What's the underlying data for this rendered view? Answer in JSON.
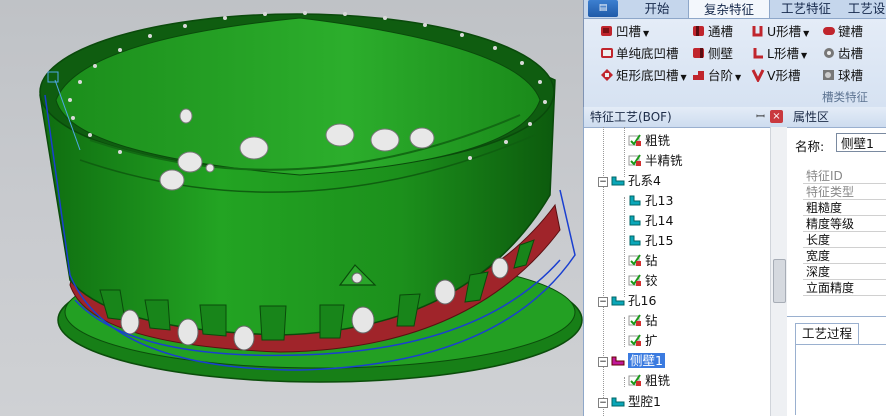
{
  "ribbon": {
    "app_button": "",
    "tabs": [
      {
        "label": "开始"
      },
      {
        "label": "复杂特征",
        "active": true
      },
      {
        "label": "工艺特征"
      },
      {
        "label": "工艺设"
      }
    ],
    "buttons": [
      {
        "label": "凹槽",
        "dropdown": true,
        "icon": "groove-icon"
      },
      {
        "label": "通槽",
        "icon": "through-slot-icon"
      },
      {
        "label": "U形槽",
        "dropdown": true,
        "icon": "u-slot-icon"
      },
      {
        "label": "键槽",
        "icon": "keyway-icon"
      },
      {
        "label": "单纯底凹槽",
        "icon": "simple-bottom-groove-icon"
      },
      {
        "label": "侧壁",
        "icon": "side-wall-icon"
      },
      {
        "label": "L形槽",
        "dropdown": true,
        "icon": "l-slot-icon"
      },
      {
        "label": "齿槽",
        "icon": "tooth-slot-icon"
      },
      {
        "label": "矩形底凹槽",
        "dropdown": true,
        "icon": "rect-bottom-groove-icon"
      },
      {
        "label": "台阶",
        "dropdown": true,
        "icon": "step-icon"
      },
      {
        "label": "V形槽",
        "icon": "v-slot-icon"
      },
      {
        "label": "球槽",
        "icon": "ball-slot-icon"
      }
    ],
    "group_label": "槽类特征"
  },
  "tree_panel": {
    "title": "特征工艺(BOF)",
    "pin": "ꟷ",
    "close": "×",
    "nodes": [
      {
        "label": "粗铣",
        "icon": "operation-icon"
      },
      {
        "label": "半精铣",
        "icon": "operation-icon"
      },
      {
        "label": "孔系4",
        "icon": "feature-icon",
        "expander": "−"
      },
      {
        "label": "孔13",
        "icon": "hole-icon"
      },
      {
        "label": "孔14",
        "icon": "hole-icon"
      },
      {
        "label": "孔15",
        "icon": "hole-icon"
      },
      {
        "label": "钻",
        "icon": "operation-icon"
      },
      {
        "label": "铰",
        "icon": "operation-icon"
      },
      {
        "label": "孔16",
        "icon": "feature-icon",
        "expander": "−"
      },
      {
        "label": "钻",
        "icon": "operation-icon"
      },
      {
        "label": "扩",
        "icon": "operation-icon"
      },
      {
        "label": "侧壁1",
        "icon": "side-wall-feature-icon",
        "expander": "−",
        "selected": true
      },
      {
        "label": "粗铣",
        "icon": "operation-icon"
      },
      {
        "label": "型腔1",
        "icon": "feature-icon",
        "expander": "−"
      }
    ]
  },
  "property_panel": {
    "title": "属性区",
    "name_label": "名称:",
    "name_value": "侧壁1",
    "rows": [
      {
        "label": "特征ID",
        "dim": true
      },
      {
        "label": "特征类型",
        "dim": true
      },
      {
        "label": "粗糙度"
      },
      {
        "label": "精度等级"
      },
      {
        "label": "长度"
      },
      {
        "label": "宽度"
      },
      {
        "label": "深度"
      },
      {
        "label": "立面精度"
      }
    ],
    "process_tab": "工艺过程"
  },
  "colors": {
    "part_green": "#1f9a1f",
    "part_red": "#a0242a",
    "selection_blue": "#1a3fd0",
    "ribbon_bg": "#dde7f4",
    "tree_selection": "#3b7be0"
  }
}
